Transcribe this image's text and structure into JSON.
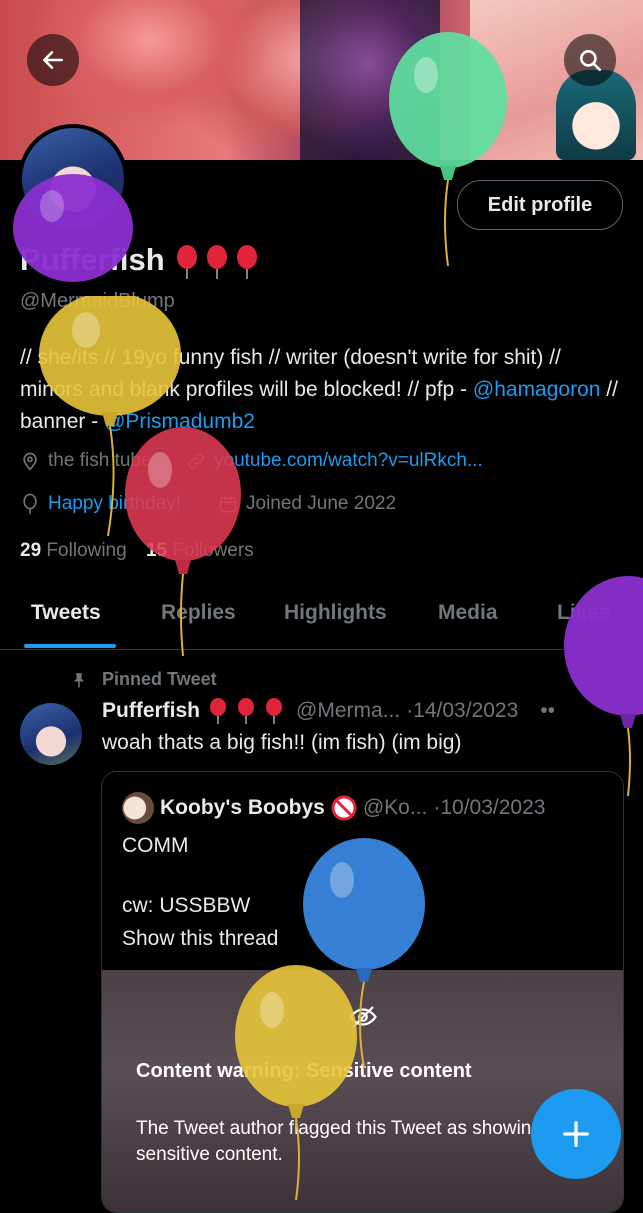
{
  "profile": {
    "display_name": "Pufferfish",
    "handle": "@MermaidBlump",
    "edit_label": "Edit profile",
    "bio_parts": {
      "p1": "// she/its // 19yo funny fish // writer (doesn't write for shit) // minors and blank profiles will be blocked! // pfp - ",
      "link1": "@hamagoron",
      "p2": " // banner - ",
      "link2": "@Prismadumb2"
    },
    "location": "the fish tube",
    "website": "youtube.com/watch?v=ulRkch...",
    "birthday": "Happy birthday!",
    "joined": "Joined June 2022",
    "following_count": "29",
    "following_label": "Following",
    "followers_count": "15",
    "followers_label": "Followers"
  },
  "tabs": [
    "Tweets",
    "Replies",
    "Highlights",
    "Media",
    "Likes"
  ],
  "pinned_tweet": {
    "pinned_label": "Pinned Tweet",
    "author": "Pufferfish",
    "handle": "@Merma...",
    "date": "·14/03/2023",
    "text": "woah thats a big fish!! (im fish) (im big)",
    "quote": {
      "author": "Kooby's Boobys",
      "handle": "@Ko...",
      "date": "·10/03/2023",
      "line1": "COMM",
      "line2": "cw: USSBBW",
      "show_thread": "Show this thread",
      "cw_title": "Content warning: Sensitive content",
      "cw_body": "The Tweet author flagged this Tweet as showing sensitive content."
    }
  },
  "icons": {
    "back": "back-arrow-icon",
    "search": "search-icon",
    "compose": "plus-icon",
    "location": "location-pin-icon",
    "link": "link-icon",
    "birthday": "balloon-icon",
    "calendar": "calendar-icon",
    "pin": "pin-icon",
    "hidden": "eye-slash-icon"
  },
  "colors": {
    "accent": "#1d9bf0",
    "background": "#000000",
    "text": "#e7e9ea",
    "muted": "#71767b",
    "balloon_purple": "#8b2fd0",
    "balloon_green": "#5ee0a0",
    "balloon_yellow": "#e8c53a",
    "balloon_red": "#e03a55",
    "balloon_blue": "#3a86e0"
  }
}
